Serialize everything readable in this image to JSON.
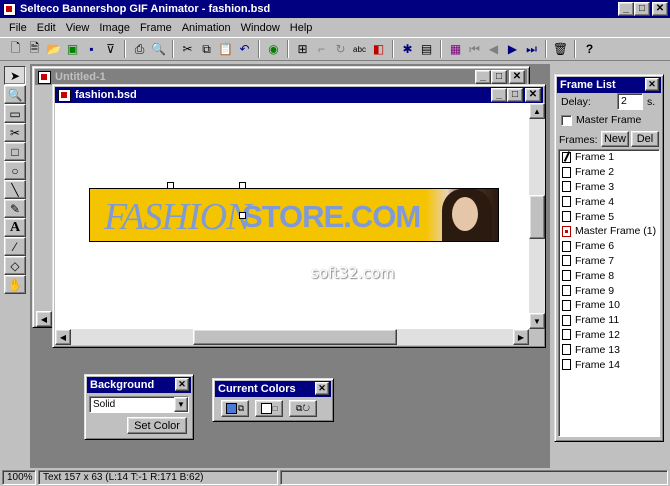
{
  "app": {
    "title": "Selteco Bannershop GIF Animator - fashion.bsd"
  },
  "menu": [
    "File",
    "Edit",
    "View",
    "Image",
    "Frame",
    "Animation",
    "Window",
    "Help"
  ],
  "toolbar": {
    "icons": [
      "new-icon",
      "new-doc-icon",
      "open-icon",
      "open-folder-icon",
      "save-all-icon",
      "save-icon",
      "filter-icon",
      "print-icon",
      "print-preview-icon",
      "cut-icon",
      "copy-icon",
      "paste-icon",
      "undo-icon",
      "preview-icon",
      "resize-icon",
      "crop-icon",
      "rotate-icon",
      "text-abc-icon",
      "layers-icon",
      "wizard-icon",
      "add-frame-icon",
      "frames-icon",
      "first-frame-icon",
      "prev-frame-icon",
      "play-icon",
      "last-frame-icon",
      "delete-icon",
      "help-icon"
    ]
  },
  "tools": [
    "select-arrow-icon",
    "zoom-icon",
    "rectangle-select-icon",
    "scissors-icon",
    "rectangle-icon",
    "ellipse-icon",
    "line-icon",
    "pencil-icon",
    "text-icon",
    "eyedropper-icon",
    "eraser-icon",
    "fill-icon"
  ],
  "doc_untitled": {
    "title": "Untitled-1"
  },
  "doc_fashion": {
    "title": "fashion.bsd"
  },
  "banner": {
    "fashion": "FASHION",
    "store": "STORE.COM",
    "bg_color": "#f5c400",
    "text_color": "#7f9ad6"
  },
  "watermark": "soft32.com",
  "frame_panel": {
    "title": "Frame List",
    "delay_label": "Delay:",
    "delay_value": "2",
    "delay_unit": "s.",
    "master_frame_label": "Master Frame",
    "frames_label": "Frames:",
    "new_label": "New",
    "del_label": "Del",
    "frames": [
      "Frame 1",
      "Frame 2",
      "Frame 3",
      "Frame 4",
      "Frame 5",
      "Master Frame (1)",
      "Frame 6",
      "Frame 7",
      "Frame 8",
      "Frame 9",
      "Frame 10",
      "Frame 11",
      "Frame 12",
      "Frame 13",
      "Frame 14"
    ]
  },
  "background_panel": {
    "title": "Background",
    "select_value": "Solid",
    "set_color_label": "Set Color"
  },
  "colors_panel": {
    "title": "Current Colors",
    "primary_color": "#4a7ad8"
  },
  "status": {
    "zoom": "100%",
    "info": "Text 157 x 63 (L:14  T:-1  R:171  B:62)"
  }
}
